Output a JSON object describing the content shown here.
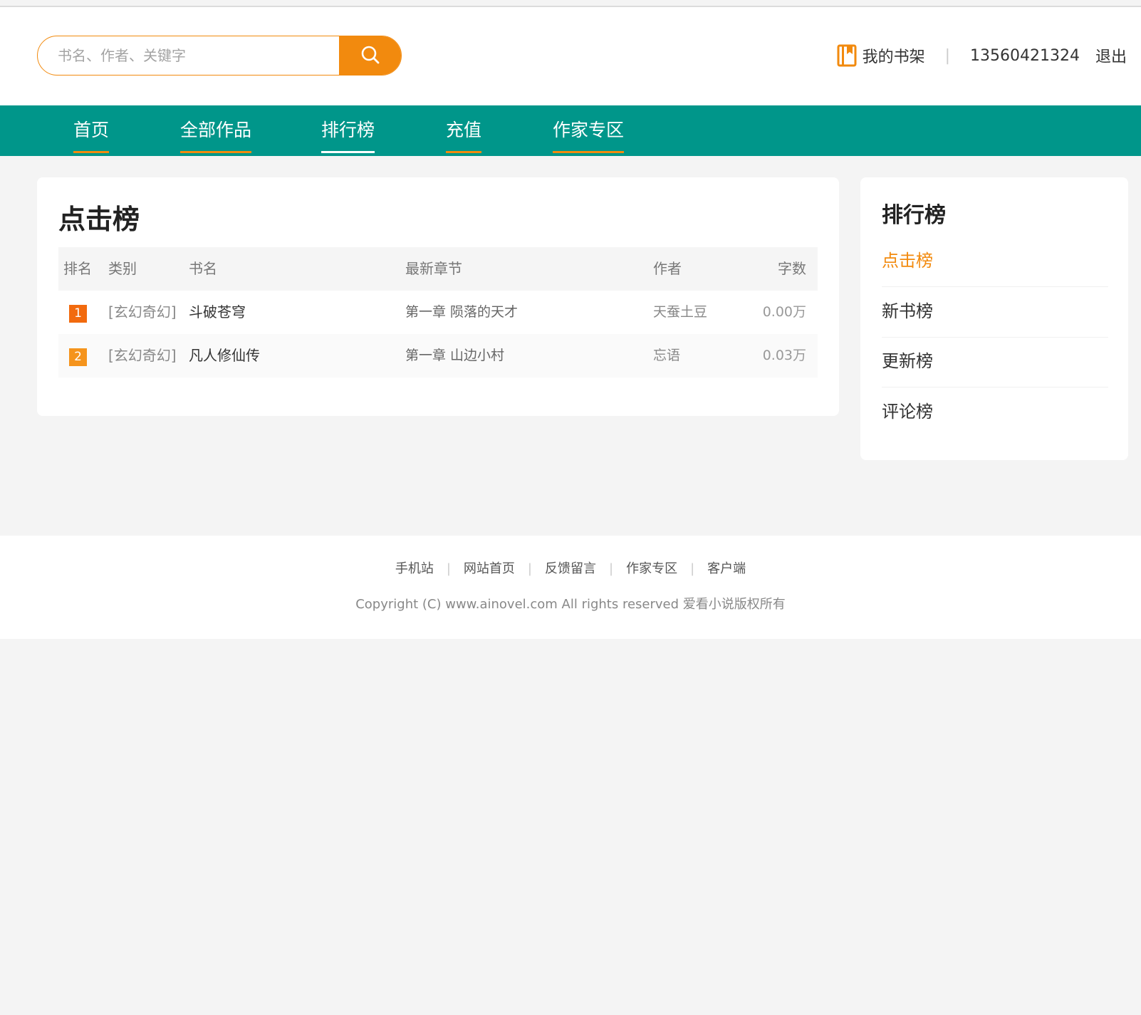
{
  "search": {
    "placeholder": "书名、作者、关键字"
  },
  "user": {
    "shelf_label": "我的书架",
    "phone": "13560421324",
    "logout_label": "退出"
  },
  "nav": {
    "items": [
      {
        "label": "首页"
      },
      {
        "label": "全部作品"
      },
      {
        "label": "排行榜",
        "active": true
      },
      {
        "label": "充值"
      },
      {
        "label": "作家专区"
      }
    ]
  },
  "main": {
    "title": "点击榜",
    "columns": {
      "rank": "排名",
      "category": "类别",
      "name": "书名",
      "chapter": "最新章节",
      "author": "作者",
      "words": "字数"
    },
    "rows": [
      {
        "rank": "1",
        "category": "[玄幻奇幻]",
        "name": "斗破苍穹",
        "chapter": "第一章 陨落的天才",
        "author": "天蚕土豆",
        "words": "0.00万"
      },
      {
        "rank": "2",
        "category": "[玄幻奇幻]",
        "name": "凡人修仙传",
        "chapter": "第一章 山边小村",
        "author": "忘语",
        "words": "0.03万"
      }
    ]
  },
  "sidebar": {
    "title": "排行榜",
    "items": [
      {
        "label": "点击榜",
        "active": true
      },
      {
        "label": "新书榜"
      },
      {
        "label": "更新榜"
      },
      {
        "label": "评论榜"
      }
    ]
  },
  "footer": {
    "links": [
      "手机站",
      "网站首页",
      "反馈留言",
      "作家专区",
      "客户端"
    ],
    "copyright": "Copyright (C) www.ainovel.com All rights reserved  爱看小说版权所有"
  },
  "colors": {
    "accent": "#f28a0e",
    "nav_bg": "#00968a",
    "rank1": "#f26a0e",
    "rank2": "#f5941d"
  }
}
